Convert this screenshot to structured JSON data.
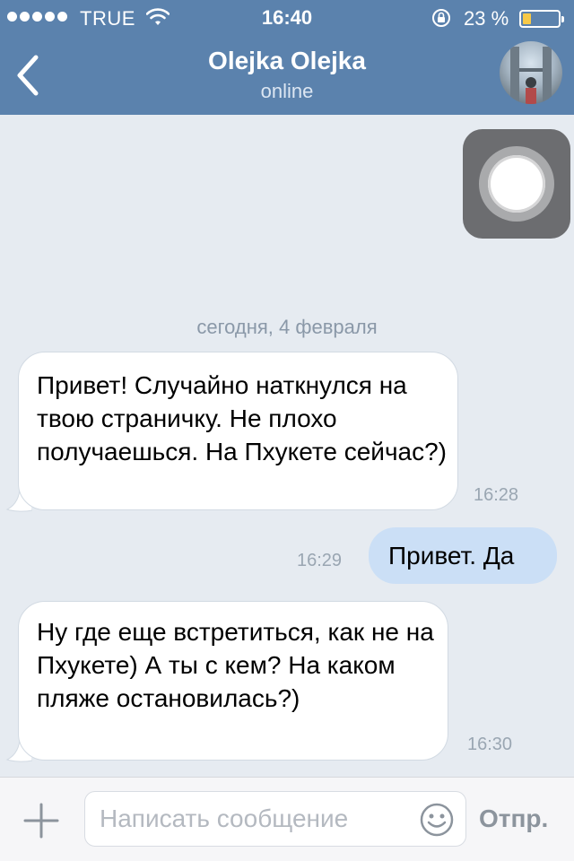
{
  "status_bar": {
    "carrier": "TRUE",
    "time": "16:40",
    "battery_percent": "23 %",
    "battery_level": 0.23,
    "battery_color": "#f7c948",
    "icons": [
      "signal-dots",
      "wifi-icon",
      "rotation-lock-icon",
      "battery-icon"
    ]
  },
  "nav": {
    "title": "Olejka Olejka",
    "subtitle": "online",
    "back_icon": "chevron-left-icon",
    "avatar": "avatar",
    "bar_color": "#5b82ad"
  },
  "chat": {
    "date_separator": "сегодня, 4 февраля",
    "messages": [
      {
        "direction": "incoming",
        "text": "Привет! Случайно наткнулся на твою страничку. Не плохо получаешься. На Пхукете сейчас?)",
        "time": "16:28"
      },
      {
        "direction": "outgoing",
        "text": "Привет. Да",
        "time": "16:29"
      },
      {
        "direction": "incoming",
        "text": "Ну где еще встретиться, как не на Пхукете) А ты с кем? На каком пляже остановилась?)",
        "time": "16:30"
      }
    ],
    "incoming_bubble_color": "#ffffff",
    "outgoing_bubble_color": "#cbdff6",
    "background_color": "#e6ebf1"
  },
  "input_bar": {
    "placeholder": "Написать сообщение",
    "value": "",
    "send_label": "Отпр.",
    "attach_icon": "plus-icon",
    "emoji_icon": "smiley-icon"
  },
  "overlay": {
    "assistive_touch_icon": "assistive-touch-icon"
  }
}
